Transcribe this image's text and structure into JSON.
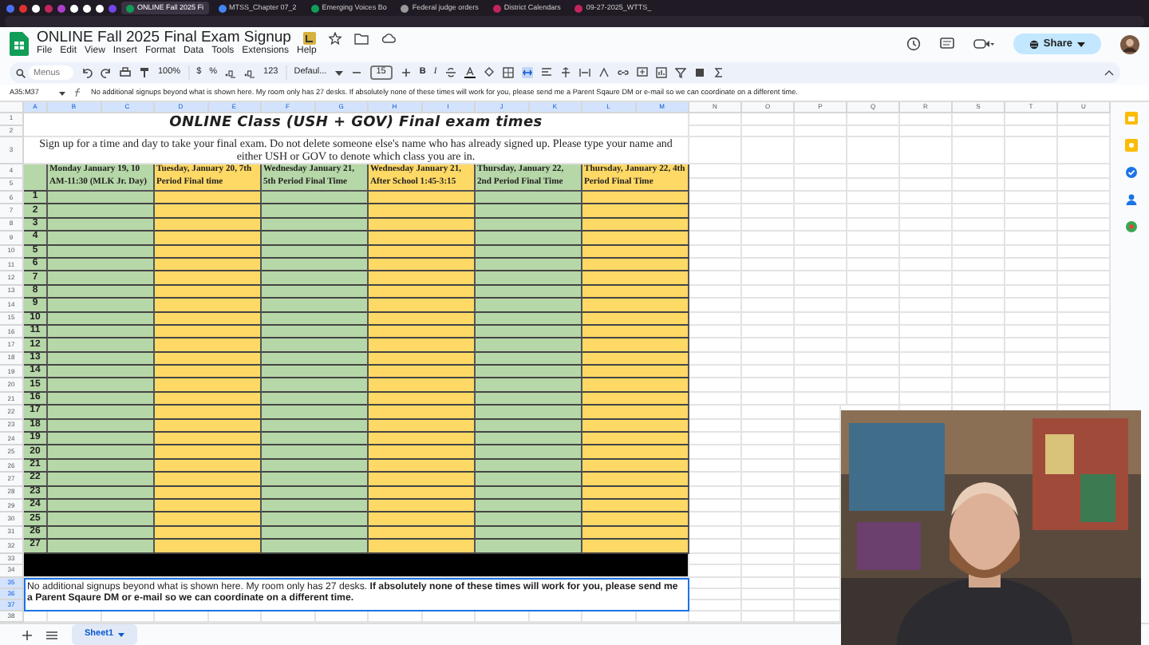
{
  "browser_tabs": [
    {
      "label": "ONLINE Fall 2025 Fi",
      "selected": true
    },
    {
      "label": "MTSS_Chapter 07_2",
      "selected": false
    },
    {
      "label": "Emerging Voices Bo",
      "selected": false
    },
    {
      "label": "Federal judge orders",
      "selected": false
    },
    {
      "label": "District Calendars",
      "selected": false
    },
    {
      "label": "09-27-2025_WTTS_",
      "selected": false
    }
  ],
  "doc_title": "ONLINE Fall 2025 Final Exam Signup",
  "menu": [
    "File",
    "Edit",
    "View",
    "Insert",
    "Format",
    "Data",
    "Tools",
    "Extensions",
    "Help"
  ],
  "share": "Share",
  "toolbar": {
    "search": {
      "placeholder": "Menus"
    },
    "zoom": "100%",
    "currency": "$",
    "percent": "%",
    "number_format": "123",
    "font": "Defaul...",
    "font_size": "15",
    "bold": "B",
    "italic": "I"
  },
  "name_box": "A35:M37",
  "formula": "No additional signups beyond what is shown here. My room only has 27 desks. If absolutely none of these times will work for you, please send me a Parent Sqaure DM or e-mail so we can coordinate on a different time.",
  "columns": [
    "A",
    "B",
    "C",
    "D",
    "E",
    "F",
    "G",
    "H",
    "I",
    "J",
    "K",
    "L",
    "M",
    "N",
    "O",
    "P",
    "Q",
    "R",
    "S",
    "T",
    "U"
  ],
  "row_numbers": [
    "1",
    "2",
    "3",
    "4",
    "5",
    "6",
    "7",
    "8",
    "9",
    "10",
    "11",
    "12",
    "13",
    "14",
    "15",
    "16",
    "17",
    "18",
    "19",
    "20",
    "21",
    "22",
    "23",
    "24",
    "25",
    "26",
    "27",
    "28",
    "29",
    "30",
    "31",
    "32",
    "33",
    "34",
    "35",
    "36",
    "37",
    "38"
  ],
  "sheet": {
    "title": "ONLINE Class (USH + GOV) Final exam times",
    "description": "Sign up for a time and day to take your final exam. Do not delete someone else's name who has already signed up. Please type your name and either USH or GOV to denote which class you are in.",
    "days": [
      {
        "label": "Monday January 19, 10 AM-11:30 (MLK Jr. Day)",
        "color": "#b6d7a8"
      },
      {
        "label": "Tuesday, January 20, 7th Period Final time",
        "color": "#ffd966"
      },
      {
        "label": "Wednesday January 21, 5th Period Final Time",
        "color": "#b6d7a8"
      },
      {
        "label": "Wednesday January 21, After School 1:45-3:15",
        "color": "#ffd966"
      },
      {
        "label": "Thursday, January 22, 2nd Period Final Time",
        "color": "#b6d7a8"
      },
      {
        "label": "Thursday, January 22, 4th Period Final Time",
        "color": "#ffd966"
      }
    ],
    "slots": [
      "1",
      "2",
      "3",
      "4",
      "5",
      "6",
      "7",
      "8",
      "9",
      "10",
      "11",
      "12",
      "13",
      "14",
      "15",
      "16",
      "17",
      "18",
      "19",
      "20",
      "21",
      "22",
      "23",
      "24",
      "25",
      "26",
      "27"
    ],
    "note": "No additional signups beyond what is shown here. My room only has 27 desks. **If absolutely none of these times will work for you, please send me a Parent Sqaure DM or e-mail so we can coordinate on a different time.**"
  },
  "sheet_tabs": [
    {
      "label": "Sheet1",
      "selected": true
    }
  ]
}
